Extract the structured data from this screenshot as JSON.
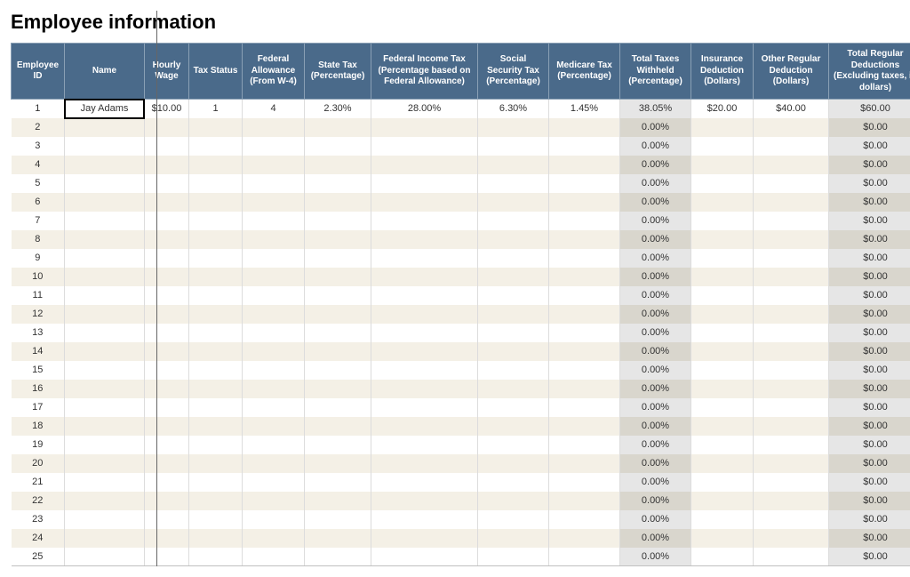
{
  "page": {
    "title": "Employee information"
  },
  "columns": [
    "Employee ID",
    "Name",
    "Hourly Wage",
    "Tax Status",
    "Federal Allowance (From W-4)",
    "State Tax (Percentage)",
    "Federal Income Tax (Percentage based on Federal Allowance)",
    "Social Security Tax (Percentage)",
    "Medicare Tax (Percentage)",
    "Total Taxes Withheld (Percentage)",
    "Insurance Deduction (Dollars)",
    "Other Regular Deduction (Dollars)",
    "Total Regular Deductions (Excluding taxes, in dollars)"
  ],
  "rows": [
    {
      "id": "1",
      "name": "Jay Adams",
      "wage": "$10.00",
      "tax_status": "1",
      "fed_allow": "4",
      "state_tax": "2.30%",
      "fit": "28.00%",
      "ss": "6.30%",
      "med": "1.45%",
      "total_withheld": "38.05%",
      "insurance": "$20.00",
      "other": "$40.00",
      "total_deduct": "$60.00"
    },
    {
      "id": "2",
      "name": "",
      "wage": "",
      "tax_status": "",
      "fed_allow": "",
      "state_tax": "",
      "fit": "",
      "ss": "",
      "med": "",
      "total_withheld": "0.00%",
      "insurance": "",
      "other": "",
      "total_deduct": "$0.00"
    },
    {
      "id": "3",
      "name": "",
      "wage": "",
      "tax_status": "",
      "fed_allow": "",
      "state_tax": "",
      "fit": "",
      "ss": "",
      "med": "",
      "total_withheld": "0.00%",
      "insurance": "",
      "other": "",
      "total_deduct": "$0.00"
    },
    {
      "id": "4",
      "name": "",
      "wage": "",
      "tax_status": "",
      "fed_allow": "",
      "state_tax": "",
      "fit": "",
      "ss": "",
      "med": "",
      "total_withheld": "0.00%",
      "insurance": "",
      "other": "",
      "total_deduct": "$0.00"
    },
    {
      "id": "5",
      "name": "",
      "wage": "",
      "tax_status": "",
      "fed_allow": "",
      "state_tax": "",
      "fit": "",
      "ss": "",
      "med": "",
      "total_withheld": "0.00%",
      "insurance": "",
      "other": "",
      "total_deduct": "$0.00"
    },
    {
      "id": "6",
      "name": "",
      "wage": "",
      "tax_status": "",
      "fed_allow": "",
      "state_tax": "",
      "fit": "",
      "ss": "",
      "med": "",
      "total_withheld": "0.00%",
      "insurance": "",
      "other": "",
      "total_deduct": "$0.00"
    },
    {
      "id": "7",
      "name": "",
      "wage": "",
      "tax_status": "",
      "fed_allow": "",
      "state_tax": "",
      "fit": "",
      "ss": "",
      "med": "",
      "total_withheld": "0.00%",
      "insurance": "",
      "other": "",
      "total_deduct": "$0.00"
    },
    {
      "id": "8",
      "name": "",
      "wage": "",
      "tax_status": "",
      "fed_allow": "",
      "state_tax": "",
      "fit": "",
      "ss": "",
      "med": "",
      "total_withheld": "0.00%",
      "insurance": "",
      "other": "",
      "total_deduct": "$0.00"
    },
    {
      "id": "9",
      "name": "",
      "wage": "",
      "tax_status": "",
      "fed_allow": "",
      "state_tax": "",
      "fit": "",
      "ss": "",
      "med": "",
      "total_withheld": "0.00%",
      "insurance": "",
      "other": "",
      "total_deduct": "$0.00"
    },
    {
      "id": "10",
      "name": "",
      "wage": "",
      "tax_status": "",
      "fed_allow": "",
      "state_tax": "",
      "fit": "",
      "ss": "",
      "med": "",
      "total_withheld": "0.00%",
      "insurance": "",
      "other": "",
      "total_deduct": "$0.00"
    },
    {
      "id": "11",
      "name": "",
      "wage": "",
      "tax_status": "",
      "fed_allow": "",
      "state_tax": "",
      "fit": "",
      "ss": "",
      "med": "",
      "total_withheld": "0.00%",
      "insurance": "",
      "other": "",
      "total_deduct": "$0.00"
    },
    {
      "id": "12",
      "name": "",
      "wage": "",
      "tax_status": "",
      "fed_allow": "",
      "state_tax": "",
      "fit": "",
      "ss": "",
      "med": "",
      "total_withheld": "0.00%",
      "insurance": "",
      "other": "",
      "total_deduct": "$0.00"
    },
    {
      "id": "13",
      "name": "",
      "wage": "",
      "tax_status": "",
      "fed_allow": "",
      "state_tax": "",
      "fit": "",
      "ss": "",
      "med": "",
      "total_withheld": "0.00%",
      "insurance": "",
      "other": "",
      "total_deduct": "$0.00"
    },
    {
      "id": "14",
      "name": "",
      "wage": "",
      "tax_status": "",
      "fed_allow": "",
      "state_tax": "",
      "fit": "",
      "ss": "",
      "med": "",
      "total_withheld": "0.00%",
      "insurance": "",
      "other": "",
      "total_deduct": "$0.00"
    },
    {
      "id": "15",
      "name": "",
      "wage": "",
      "tax_status": "",
      "fed_allow": "",
      "state_tax": "",
      "fit": "",
      "ss": "",
      "med": "",
      "total_withheld": "0.00%",
      "insurance": "",
      "other": "",
      "total_deduct": "$0.00"
    },
    {
      "id": "16",
      "name": "",
      "wage": "",
      "tax_status": "",
      "fed_allow": "",
      "state_tax": "",
      "fit": "",
      "ss": "",
      "med": "",
      "total_withheld": "0.00%",
      "insurance": "",
      "other": "",
      "total_deduct": "$0.00"
    },
    {
      "id": "17",
      "name": "",
      "wage": "",
      "tax_status": "",
      "fed_allow": "",
      "state_tax": "",
      "fit": "",
      "ss": "",
      "med": "",
      "total_withheld": "0.00%",
      "insurance": "",
      "other": "",
      "total_deduct": "$0.00"
    },
    {
      "id": "18",
      "name": "",
      "wage": "",
      "tax_status": "",
      "fed_allow": "",
      "state_tax": "",
      "fit": "",
      "ss": "",
      "med": "",
      "total_withheld": "0.00%",
      "insurance": "",
      "other": "",
      "total_deduct": "$0.00"
    },
    {
      "id": "19",
      "name": "",
      "wage": "",
      "tax_status": "",
      "fed_allow": "",
      "state_tax": "",
      "fit": "",
      "ss": "",
      "med": "",
      "total_withheld": "0.00%",
      "insurance": "",
      "other": "",
      "total_deduct": "$0.00"
    },
    {
      "id": "20",
      "name": "",
      "wage": "",
      "tax_status": "",
      "fed_allow": "",
      "state_tax": "",
      "fit": "",
      "ss": "",
      "med": "",
      "total_withheld": "0.00%",
      "insurance": "",
      "other": "",
      "total_deduct": "$0.00"
    },
    {
      "id": "21",
      "name": "",
      "wage": "",
      "tax_status": "",
      "fed_allow": "",
      "state_tax": "",
      "fit": "",
      "ss": "",
      "med": "",
      "total_withheld": "0.00%",
      "insurance": "",
      "other": "",
      "total_deduct": "$0.00"
    },
    {
      "id": "22",
      "name": "",
      "wage": "",
      "tax_status": "",
      "fed_allow": "",
      "state_tax": "",
      "fit": "",
      "ss": "",
      "med": "",
      "total_withheld": "0.00%",
      "insurance": "",
      "other": "",
      "total_deduct": "$0.00"
    },
    {
      "id": "23",
      "name": "",
      "wage": "",
      "tax_status": "",
      "fed_allow": "",
      "state_tax": "",
      "fit": "",
      "ss": "",
      "med": "",
      "total_withheld": "0.00%",
      "insurance": "",
      "other": "",
      "total_deduct": "$0.00"
    },
    {
      "id": "24",
      "name": "",
      "wage": "",
      "tax_status": "",
      "fed_allow": "",
      "state_tax": "",
      "fit": "",
      "ss": "",
      "med": "",
      "total_withheld": "0.00%",
      "insurance": "",
      "other": "",
      "total_deduct": "$0.00"
    },
    {
      "id": "25",
      "name": "",
      "wage": "",
      "tax_status": "",
      "fed_allow": "",
      "state_tax": "",
      "fit": "",
      "ss": "",
      "med": "",
      "total_withheld": "0.00%",
      "insurance": "",
      "other": "",
      "total_deduct": "$0.00"
    }
  ],
  "selected_cell": {
    "row": 0,
    "col": "name"
  }
}
